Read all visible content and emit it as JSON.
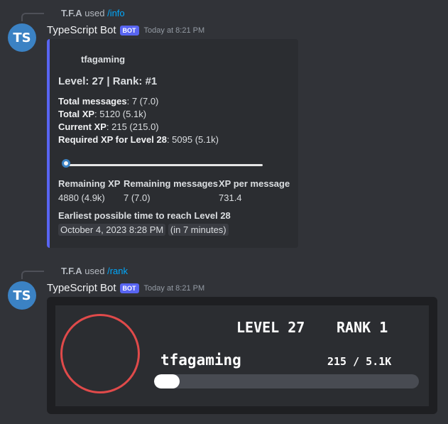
{
  "messages": [
    {
      "reply": {
        "user": "T.F.A",
        "used": "used",
        "command": "/info"
      },
      "avatar_initials": "TS",
      "author": "TypeScript Bot",
      "bot_tag": "BOT",
      "timestamp": "Today at 8:21 PM",
      "embed": {
        "accent_color": "#5865f2",
        "author_name": "tfagaming",
        "title": "Level: 27 | Rank: #1",
        "stats": [
          {
            "key": "Total messages",
            "value": ": 7 (7.0)"
          },
          {
            "key": "Total XP",
            "value": ": 5120 (5.1k)"
          },
          {
            "key": "Current XP",
            "value": ": 215 (215.0)"
          },
          {
            "key": "Required XP for Level 28",
            "value": ": 5095 (5.1k)"
          }
        ],
        "progress_fraction": 0.0,
        "fields": [
          {
            "name": "Remaining XP",
            "value": "4880 (4.9k)"
          },
          {
            "name": "Remaining messages",
            "value": "7 (7.0)"
          },
          {
            "name": "XP per message",
            "value": "731.4"
          }
        ],
        "earliest_title": "Earliest possible time to reach Level 28",
        "earliest_time": "October 4, 2023 8:28 PM",
        "earliest_relative": "(in 7 minutes)"
      }
    },
    {
      "reply": {
        "user": "T.F.A",
        "used": "used",
        "command": "/rank"
      },
      "avatar_initials": "TS",
      "author": "TypeScript Bot",
      "bot_tag": "BOT",
      "timestamp": "Today at 8:21 PM",
      "rank_card": {
        "level_text": "LEVEL 27",
        "rank_text": "RANK 1",
        "username": "tfagaming",
        "xp_text": "215 / 5.1K",
        "xp_fraction": 0.042,
        "ring_color": "#e04a4a"
      }
    }
  ]
}
